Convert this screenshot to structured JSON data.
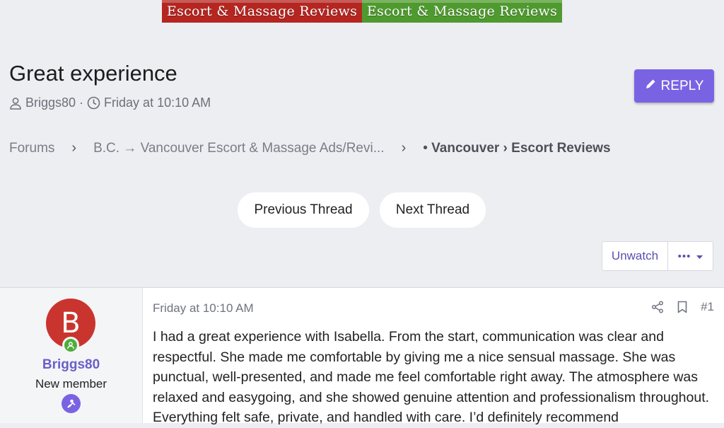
{
  "banner": {
    "left_text": "Escort & Massage Reviews",
    "right_text": "Escort & Massage Reviews",
    "left_color": "#b52620",
    "right_color": "#4f9a2f"
  },
  "thread": {
    "title": "Great experience",
    "author": "Briggs80",
    "dot": "·",
    "date": "Friday at 10:10 AM",
    "reply_label": "REPLY"
  },
  "breadcrumb": {
    "items": [
      "Forums",
      "B.C. → Vancouver Escort & Massage Ads/Revi..."
    ],
    "separator": "›",
    "current_prefix": "• ",
    "current_bold": "Vancouver",
    "current_rest": " › Escort Reviews"
  },
  "nav": {
    "previous": "Previous Thread",
    "next": "Next Thread"
  },
  "watch": {
    "unwatch_label": "Unwatch",
    "more_label": "•••"
  },
  "post": {
    "avatar_letter": "B",
    "username": "Briggs80",
    "user_title": "New member",
    "date": "Friday at 10:10 AM",
    "number": "#1",
    "body": "I had a great experience with Isabella. From the start, communication was clear and respectful. She made me comfortable by giving me a nice sensual massage. She was punctual, well-presented, and made me feel comfortable right away. The atmosphere was relaxed and easygoing, and she showed genuine attention and professionalism throughout. Everything felt safe, private, and handled with care. I’d definitely recommend"
  },
  "colors": {
    "accent": "#7a63e3",
    "link": "#5a4fb2",
    "avatar": "#c9352e",
    "online": "#4fad3b",
    "page_bg": "#eceef2"
  },
  "icons": [
    "user-icon",
    "clock-icon",
    "pencil-icon",
    "chevron-down-icon",
    "share-icon",
    "bookmark-icon",
    "online-status-icon",
    "badge-icon"
  ]
}
